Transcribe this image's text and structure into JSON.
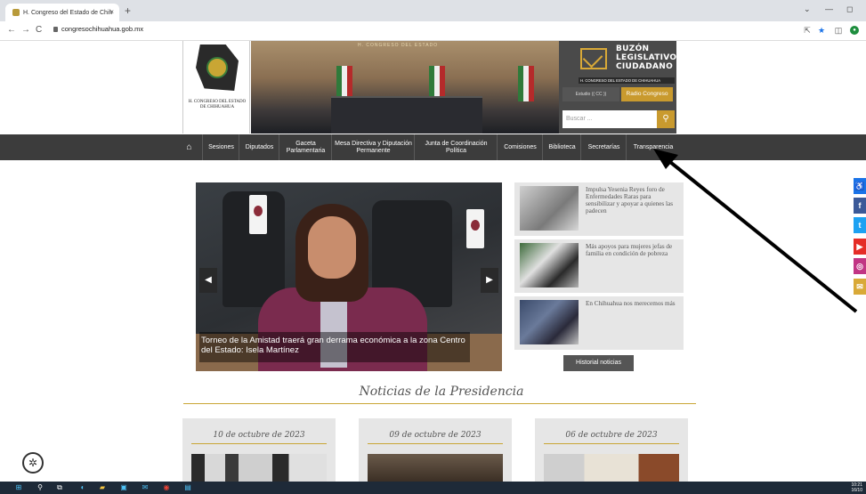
{
  "browser": {
    "tab_title": "H. Congreso del Estado de Chih",
    "tab_close": "×",
    "new_tab": "+",
    "url": "congresochihuahua.gob.mx",
    "back": "←",
    "forward": "→",
    "reload": "C",
    "minimize": "—",
    "chevron": "⌄",
    "restore": "◻"
  },
  "header": {
    "hero_caption": "H. CONGRESO DEL ESTADO",
    "logo_text": "H. CONGRESO DEL ESTADO DE CHIHUAHUA",
    "buzon_title": [
      "BUZÓN",
      "LEGISLATIVO",
      "CIUDADANO"
    ],
    "buzon_sub": "H. CONGRESO DEL ESTADO DE CHIHUAHUA",
    "estudio": "Estudio (( CC ))",
    "radio": "Radio Congreso",
    "search_placeholder": "Buscar ...",
    "search_icon": "magnifier-icon"
  },
  "nav": {
    "home_icon": "home-icon",
    "items": [
      "Sesiones",
      "Diputados",
      "Gaceta Parlamentaria",
      "Mesa Directiva y Diputación Permanente",
      "Junta de Coordinación Política",
      "Comisiones",
      "Biblioteca",
      "Secretarías",
      "Transparencia"
    ]
  },
  "slider": {
    "caption": "Torneo de la Amistad traerá gran derrama económica a la zona Centro del Estado: Isela Martínez",
    "prev": "◀",
    "next": "▶"
  },
  "news": [
    "Impulsa Yesenia Reyes foro de Enfermedades Raras para sensibilizar y apoyar a quienes las padecen",
    "Más apoyos para mujeres jefas de familia en condición de pobreza",
    "En Chihuahua nos merecemos más"
  ],
  "history_button": "Historial noticias",
  "presidencia_title": "Noticias de la Presidencia",
  "presidencia_cards": [
    "10 de octubre de 2023",
    "09 de octubre de 2023",
    "06 de octubre de 2023"
  ],
  "social": [
    "♿",
    "f",
    "t",
    "▶",
    "◎",
    "✉"
  ],
  "colors": {
    "gold": "#c9a634",
    "nav_bg": "#3c3c3c",
    "card_bg": "#e6e6e6",
    "facebook": "#3b5998",
    "twitter": "#1da1f2",
    "youtube": "#e52d27",
    "instagram": "#c13584",
    "mail": "#d9a937"
  },
  "taskbar": {
    "time": "10:21",
    "date": "16/10"
  }
}
